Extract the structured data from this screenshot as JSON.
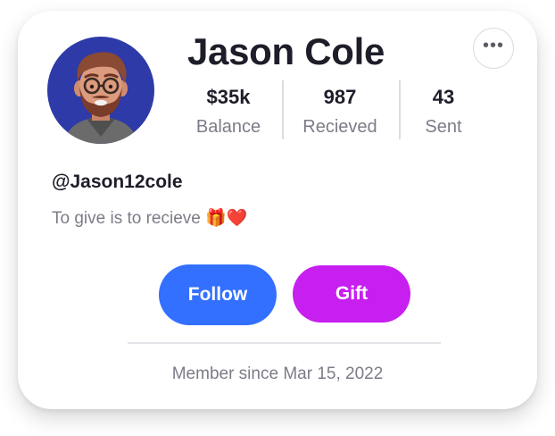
{
  "profile": {
    "name": "Jason Cole",
    "handle": "@Jason12cole",
    "bio": "To give is to recieve 🎁❤️",
    "avatar_icon": "avatar-3d-bearded-man-glasses",
    "member_since": "Member since Mar 15, 2022"
  },
  "stats": [
    {
      "value": "$35k",
      "label": "Balance"
    },
    {
      "value": "987",
      "label": "Recieved"
    },
    {
      "value": "43",
      "label": "Sent"
    }
  ],
  "actions": {
    "follow_label": "Follow",
    "gift_label": "Gift",
    "more_icon": "more-horizontal-icon"
  },
  "colors": {
    "follow": "#3370ff",
    "gift": "#c71ff0",
    "avatar_bg": "#2e3aa8",
    "text_primary": "#1e1e2a",
    "text_secondary": "#7c7c88"
  }
}
